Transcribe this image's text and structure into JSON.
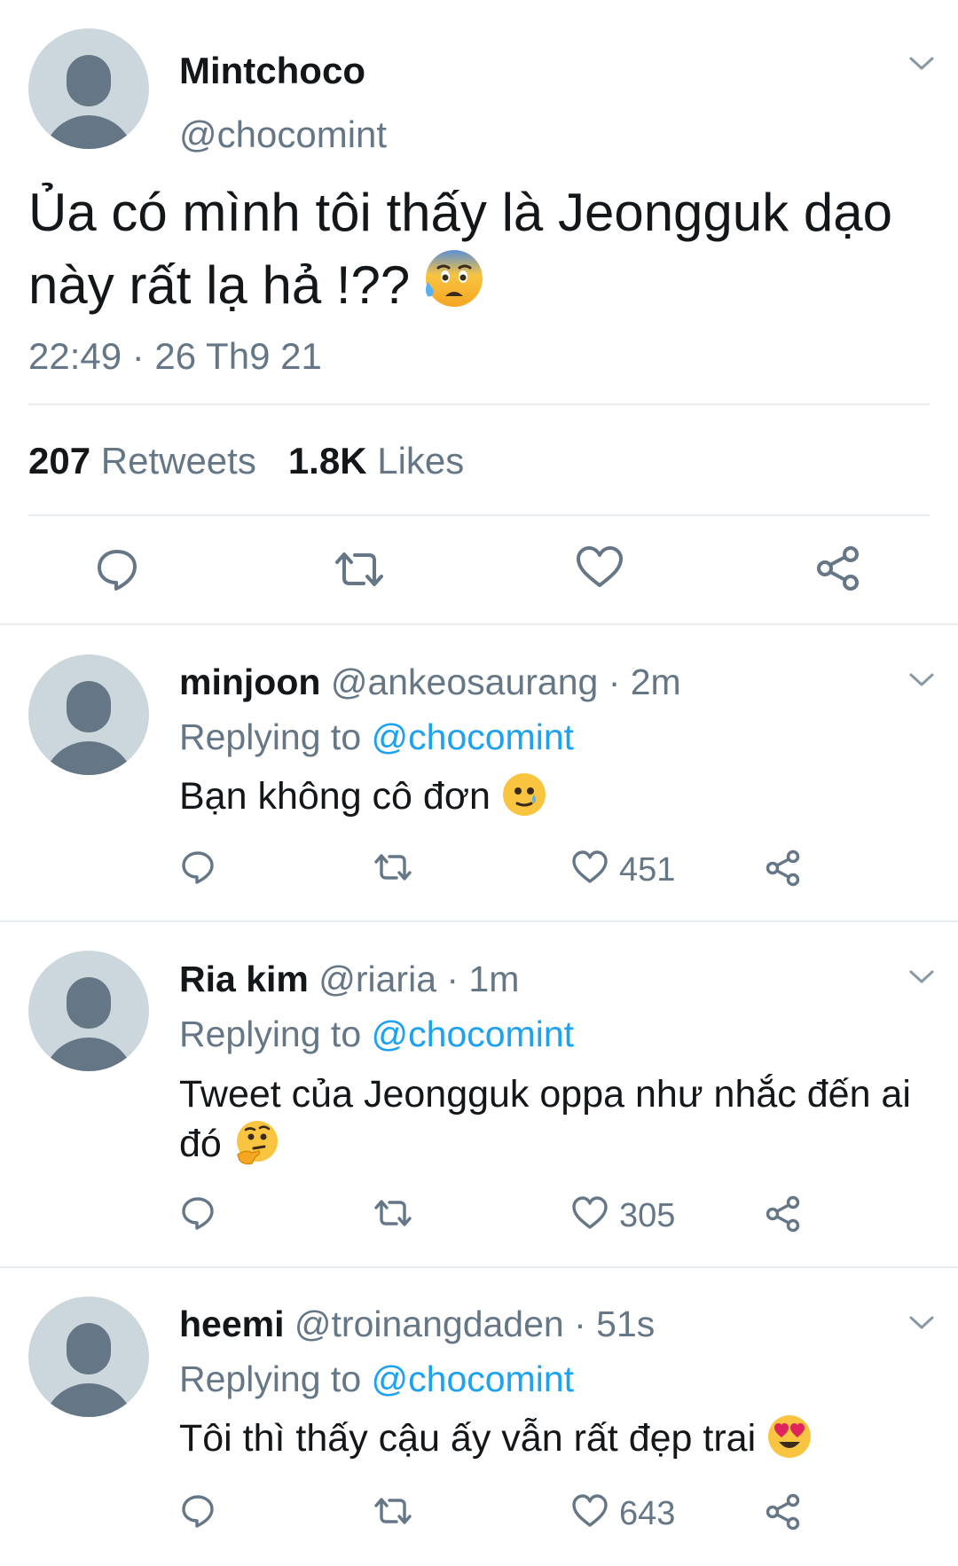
{
  "main_tweet": {
    "name": "Mintchoco",
    "handle": "@chocomint",
    "text": "Ủa có mình tôi thấy là Jeongguk dạo này rất lạ hả !??",
    "emoji": "anxious-face-with-sweat",
    "timestamp": "22:49 · 26 Th9 21",
    "retweets_count": "207",
    "retweets_label": "Retweets",
    "likes_count": "1.8K",
    "likes_label": "Likes"
  },
  "replies": [
    {
      "name": "minjoon",
      "meta": "@ankeosaurang · 2m",
      "replying_prefix": "Replying to",
      "replying_handle": "@chocomint",
      "text": "Bạn không cô đơn",
      "emoji": "face-holding-back-tears",
      "likes": "451"
    },
    {
      "name": "Ria kim",
      "meta": "@riaria · 1m",
      "replying_prefix": "Replying to",
      "replying_handle": "@chocomint",
      "text": "Tweet của Jeongguk oppa như nhắc đến ai đó",
      "emoji": "thinking-face",
      "likes": "305"
    },
    {
      "name": "heemi",
      "meta": "@troinangdaden · 51s",
      "replying_prefix": "Replying to",
      "replying_handle": "@chocomint",
      "text": "Tôi thì thấy cậu ấy vẫn rất đẹp trai",
      "emoji": "smiling-face-with-heart-eyes",
      "likes": "643"
    }
  ],
  "colors": {
    "text_primary": "#14171a",
    "text_secondary": "#657786",
    "link": "#1da1f2",
    "divider": "#e6ecf0",
    "avatar_bg": "#ccd6dd"
  }
}
